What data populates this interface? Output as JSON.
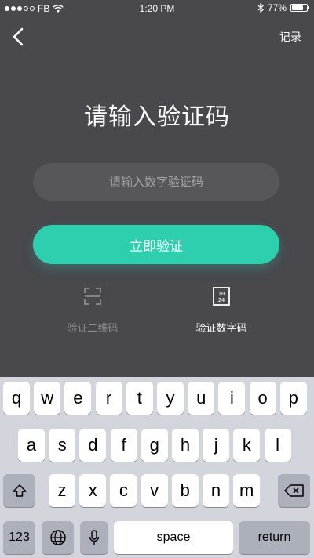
{
  "status_bar": {
    "carrier": "FB",
    "time": "1:20 PM",
    "battery": "77%",
    "battery_level": 0.77,
    "icons": [
      "signal-dots-icon",
      "wifi-icon",
      "bluetooth-icon",
      "battery-icon"
    ]
  },
  "nav": {
    "back_icon": "chevron-left-icon",
    "records_label": "记录"
  },
  "main": {
    "title": "请输入验证码",
    "input_placeholder": "请输入数字验证码",
    "input_value": "",
    "verify_button": "立即验证",
    "methods": [
      {
        "label": "验证二维码",
        "icon": "qr-scan-icon",
        "active": false
      },
      {
        "label": "验证数字码",
        "icon": "number-code-icon",
        "active": true
      }
    ]
  },
  "keyboard": {
    "row1": [
      "q",
      "w",
      "e",
      "r",
      "t",
      "y",
      "u",
      "i",
      "o",
      "p"
    ],
    "row2": [
      "a",
      "s",
      "d",
      "f",
      "g",
      "h",
      "j",
      "k",
      "l"
    ],
    "row3": [
      "z",
      "x",
      "c",
      "v",
      "b",
      "n",
      "m"
    ],
    "numbers_key": "123",
    "space_key": "space",
    "return_key": "return",
    "icons": [
      "shift-icon",
      "backspace-icon",
      "globe-icon",
      "microphone-icon"
    ]
  },
  "colors": {
    "background": "#48484d",
    "input_bg": "#56565b",
    "accent": "#2ecfae",
    "keyboard_bg": "#d2d5db"
  }
}
